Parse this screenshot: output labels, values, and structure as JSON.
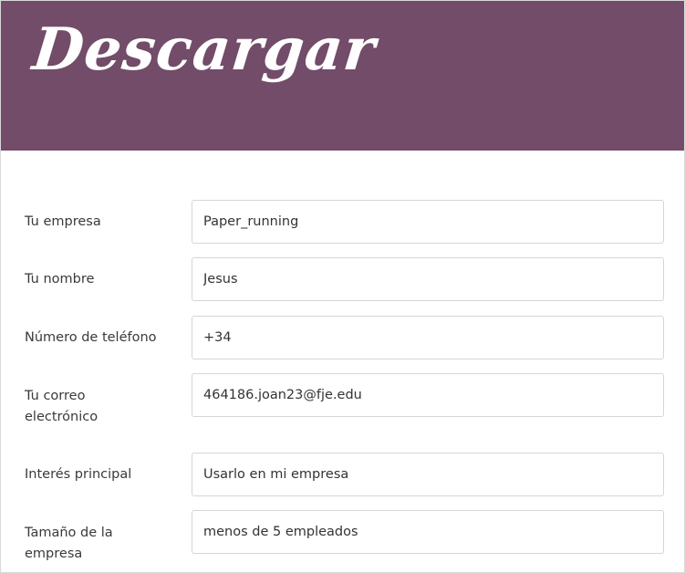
{
  "banner": {
    "title": "Descargar",
    "background_color": "#724c68",
    "text_color": "#ffffff"
  },
  "form": {
    "fields": [
      {
        "label": "Tu empresa",
        "value": "Paper_running"
      },
      {
        "label": "Tu nombre",
        "value": "Jesus"
      },
      {
        "label": "Número de teléfono",
        "value": "+34"
      },
      {
        "label": "Tu correo electrónico",
        "value": "464186.joan23@fje.edu"
      },
      {
        "label": "Interés principal",
        "value": "Usarlo en mi empresa"
      },
      {
        "label": "Tamaño de la empresa",
        "value": "menos de 5 empleados"
      }
    ]
  }
}
